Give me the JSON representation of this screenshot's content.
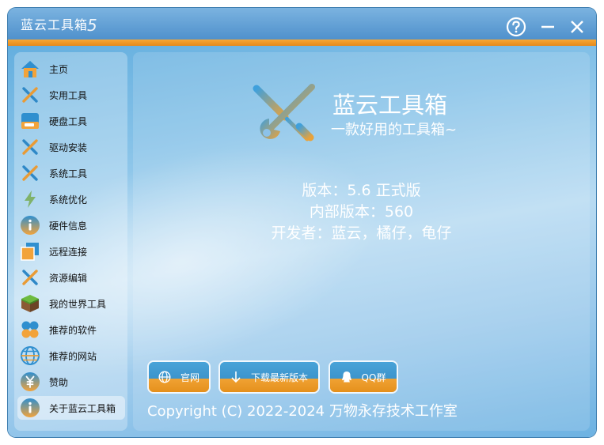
{
  "window": {
    "title": "蓝云工具箱",
    "version_badge": "5"
  },
  "titlebar_buttons": [
    "help-icon",
    "minimize-icon",
    "close-icon"
  ],
  "colors": {
    "title_blue": "#4d8fcb",
    "title_orange": "#f59b24",
    "sidebar_active": "#ffffff"
  },
  "sidebar": {
    "items": [
      {
        "label": "主页",
        "icon": "home-icon"
      },
      {
        "label": "实用工具",
        "icon": "tools-icon"
      },
      {
        "label": "硬盘工具",
        "icon": "disk-icon"
      },
      {
        "label": "驱动安装",
        "icon": "tools-icon"
      },
      {
        "label": "系统工具",
        "icon": "tools-icon"
      },
      {
        "label": "系统优化",
        "icon": "lightning-icon"
      },
      {
        "label": "硬件信息",
        "icon": "info-icon"
      },
      {
        "label": "远程连接",
        "icon": "remote-icon"
      },
      {
        "label": "资源编辑",
        "icon": "tools-icon"
      },
      {
        "label": "我的世界工具",
        "icon": "minecraft-icon"
      },
      {
        "label": "推荐的软件",
        "icon": "apps-icon"
      },
      {
        "label": "推荐的网站",
        "icon": "globe-icon"
      },
      {
        "label": "赞助",
        "icon": "yen-icon"
      },
      {
        "label": "关于蓝云工具箱",
        "icon": "info-icon"
      }
    ],
    "active_index": 13
  },
  "about": {
    "product_name": "蓝云工具箱",
    "slogan": "一款好用的工具箱~",
    "version": "版本：5.6 正式版",
    "internal_version": "内部版本：560",
    "developers": "开发者：蓝云，橘仔，龟仔",
    "buttons": {
      "website": "官网",
      "download": "下载最新版本",
      "qq_group": "QQ群"
    },
    "copyright": "Copyright  (C)  2022-2024 万物永存技术工作室"
  }
}
